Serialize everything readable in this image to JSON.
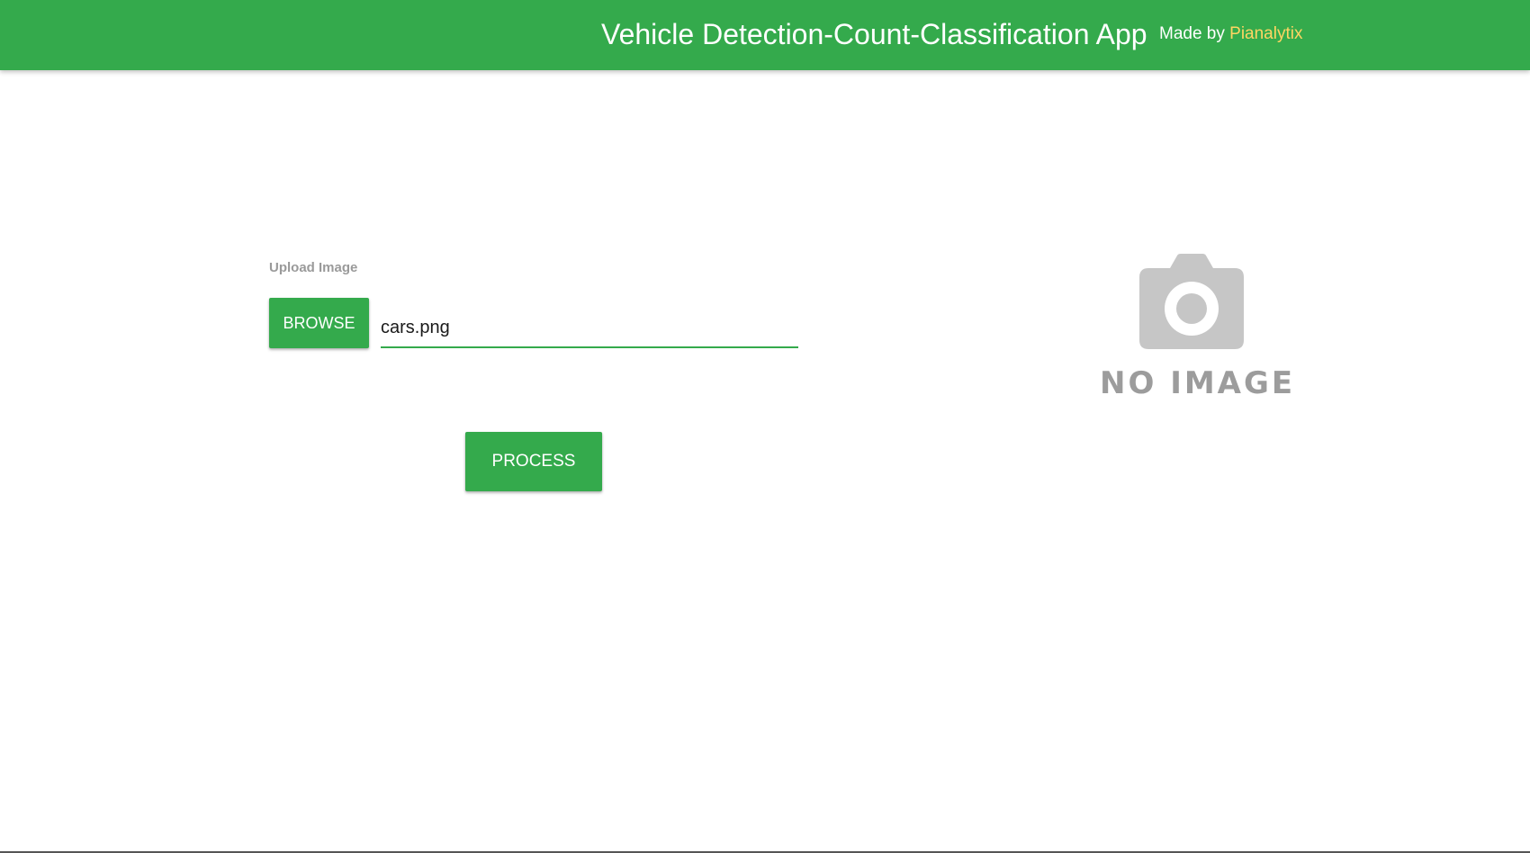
{
  "header": {
    "title": "Vehicle Detection-Count-Classification App",
    "made_by_prefix": "Made by",
    "made_by_author": "Pianalytix"
  },
  "upload": {
    "label": "Upload Image",
    "browse_label": "BROWSE",
    "file_name": "cars.png"
  },
  "actions": {
    "process_label": "PROCESS"
  },
  "preview": {
    "placeholder_text": "NO IMAGE",
    "icon": "camera-icon"
  },
  "colors": {
    "accent": "#34aa4c",
    "author_highlight": "#ffd562",
    "label_gray": "#9a9a9a",
    "placeholder_gray": "#c6c6c6"
  }
}
